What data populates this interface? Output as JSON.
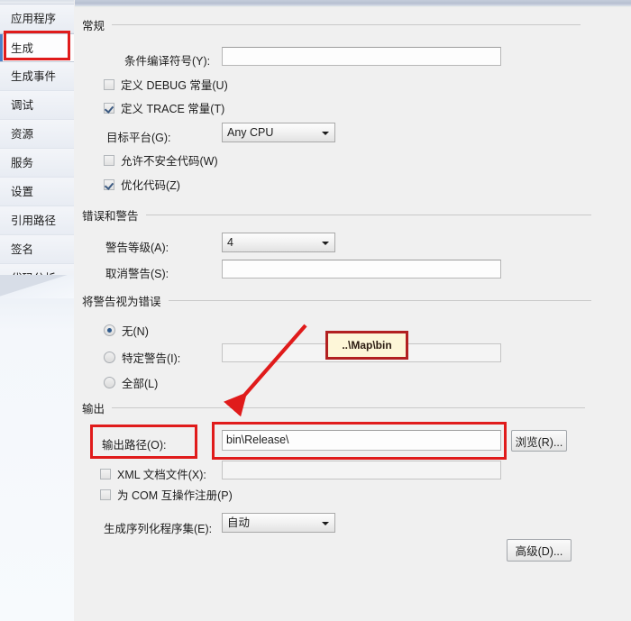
{
  "sidebar": {
    "items": [
      {
        "label": "应用程序",
        "selected": false
      },
      {
        "label": "生成",
        "selected": true
      },
      {
        "label": "生成事件",
        "selected": false
      },
      {
        "label": "调试",
        "selected": false
      },
      {
        "label": "资源",
        "selected": false
      },
      {
        "label": "服务",
        "selected": false
      },
      {
        "label": "设置",
        "selected": false
      },
      {
        "label": "引用路径",
        "selected": false
      },
      {
        "label": "签名",
        "selected": false
      },
      {
        "label": "代码分析",
        "selected": false
      }
    ]
  },
  "general": {
    "group_label": "常规",
    "conditional_symbols_label": "条件编译符号(Y):",
    "conditional_symbols_value": "",
    "define_debug_label": "定义 DEBUG 常量(U)",
    "define_debug_checked": false,
    "define_trace_label": "定义 TRACE 常量(T)",
    "define_trace_checked": true,
    "platform_target_label": "目标平台(G):",
    "platform_target_value": "Any CPU",
    "allow_unsafe_label": "允许不安全代码(W)",
    "allow_unsafe_checked": false,
    "optimize_label": "优化代码(Z)",
    "optimize_checked": true
  },
  "errors_warnings": {
    "group_label": "错误和警告",
    "warning_level_label": "警告等级(A):",
    "warning_level_value": "4",
    "suppress_warnings_label": "取消警告(S):",
    "suppress_warnings_value": ""
  },
  "treat_warnings": {
    "group_label": "将警告视为错误",
    "none_label": "无(N)",
    "none_selected": true,
    "specific_label": "特定警告(I):",
    "specific_selected": false,
    "specific_value": "",
    "all_label": "全部(L)",
    "all_selected": false
  },
  "output": {
    "group_label": "输出",
    "output_path_label": "输出路径(O):",
    "output_path_value": "bin\\Release\\",
    "browse_label": "浏览(R)...",
    "xml_doc_label": "XML 文档文件(X):",
    "xml_doc_checked": false,
    "xml_doc_value": "",
    "com_interop_label": "为 COM 互操作注册(P)",
    "com_interop_checked": false,
    "serialization_label": "生成序列化程序集(E):",
    "serialization_value": "自动",
    "advanced_label": "高级(D)..."
  },
  "annotations": {
    "callout_text": "..\\Map\\bin",
    "highlight_color": "#e01b1b",
    "callout_fill": "#fdf6d8",
    "callout_border": "#b22020"
  }
}
